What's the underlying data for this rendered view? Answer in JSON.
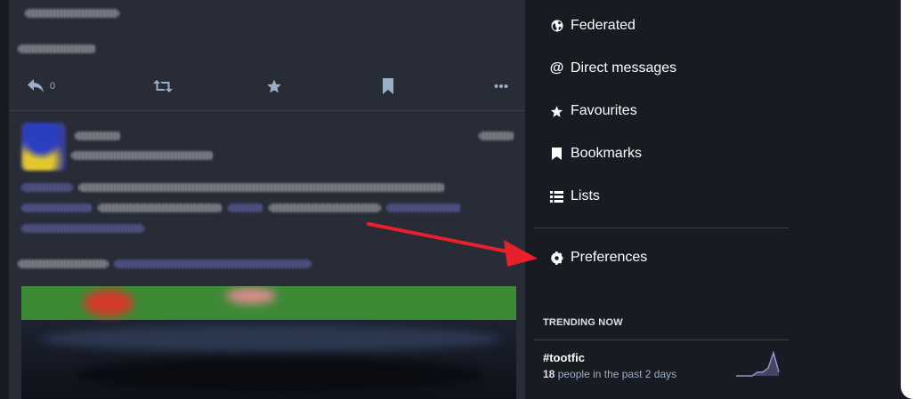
{
  "nav": {
    "items": [
      {
        "label": "Federated",
        "icon": "globe-icon"
      },
      {
        "label": "Direct messages",
        "icon": "at-icon"
      },
      {
        "label": "Favourites",
        "icon": "star-icon"
      },
      {
        "label": "Bookmarks",
        "icon": "bookmark-icon"
      },
      {
        "label": "Lists",
        "icon": "list-icon"
      }
    ],
    "preferences": {
      "label": "Preferences",
      "icon": "gear-icon"
    }
  },
  "trending": {
    "title": "TRENDING NOW",
    "tag": "#tootfic",
    "count": "18",
    "meta": "people in the past 2 days",
    "sparkline_values": [
      0,
      0,
      0,
      0,
      1,
      1,
      2,
      6,
      1
    ]
  },
  "feed": {
    "actions": {
      "reply_count": "0"
    }
  },
  "colors": {
    "page_bg": "#191b22",
    "feed_bg": "#282c37",
    "icon_muted": "#9baec8",
    "accent_arrow": "#e8202a",
    "sparkline": "#9a8ed8"
  }
}
